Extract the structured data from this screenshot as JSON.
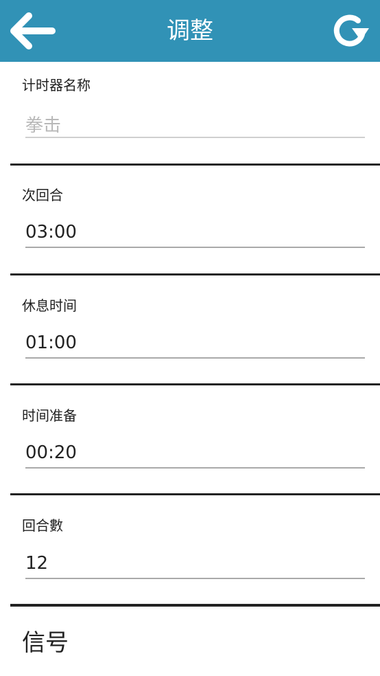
{
  "header": {
    "title": "调整",
    "back_icon": "arrow-left-icon",
    "refresh_icon": "refresh-icon",
    "background_color": "#3192b6"
  },
  "fields": {
    "timer_name": {
      "label": "计时器名称",
      "placeholder": "拳击",
      "value": ""
    },
    "round_time": {
      "label": "次回合",
      "value": "03:00"
    },
    "rest_time": {
      "label": "休息时间",
      "value": "01:00"
    },
    "prep_time": {
      "label": "时间准备",
      "value": "00:20"
    },
    "round_count": {
      "label": "回合數",
      "value": "12"
    }
  },
  "signal_section": {
    "label": "信号"
  }
}
